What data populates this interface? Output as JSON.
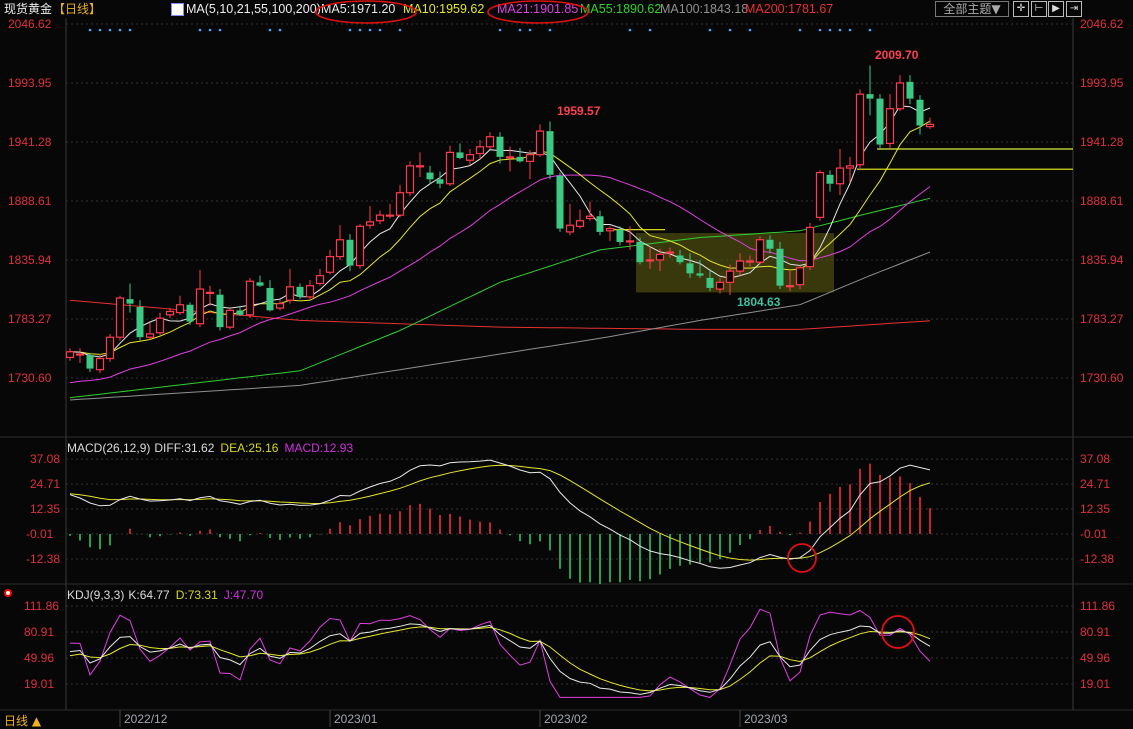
{
  "header": {
    "symbol": "现货黄金",
    "period_tag": "【日线】",
    "ma_params": "MA(5,10,21,55,100,200)",
    "ma5": "MA5:1971.20",
    "ma10": "MA10:1959.62",
    "ma21": "MA21:1901.85",
    "ma55": "MA55:1890.62",
    "ma100": "MA100:1843.18",
    "ma200": "MA200:1781.67",
    "theme_button": "全部主题▼",
    "tools": [
      "crosshair-icon",
      "zoom-range-icon",
      "play-icon",
      "step-forward-icon"
    ]
  },
  "colors": {
    "up": "#ff3b4e",
    "down": "#3cc984",
    "ma5": "#e8e8e8",
    "ma10": "#e6e62c",
    "ma21": "#e040e0",
    "ma55": "#30d030",
    "ma100": "#909090",
    "ma200": "#e83030",
    "axis": "#e0303c",
    "annotation": "#e01010",
    "highlight": "#5a5a10"
  },
  "price_axis": [
    "2046.62",
    "1993.95",
    "1941.28",
    "1888.61",
    "1835.94",
    "1783.27",
    "1730.60"
  ],
  "macd_axis": [
    "37.08",
    "24.71",
    "12.35",
    "-0.01",
    "-12.38"
  ],
  "kdj_axis": [
    "111.86",
    "80.91",
    "49.96",
    "19.01"
  ],
  "macd_title": {
    "name": "MACD(26,12,9)",
    "diff": "DIFF:31.62",
    "dea": "DEA:25.16",
    "macd": "MACD:12.93"
  },
  "kdj_title": {
    "name": "KDJ(9,3,3)",
    "k": "K:64.77",
    "d": "D:73.31",
    "j": "J:47.70"
  },
  "time_axis": [
    {
      "label": "2022/12",
      "index": 5
    },
    {
      "label": "2023/01",
      "index": 26
    },
    {
      "label": "2023/02",
      "index": 47
    },
    {
      "label": "2023/03",
      "index": 67
    }
  ],
  "footer": {
    "period": "日线 ▲"
  },
  "annotations": {
    "high1": "1959.57",
    "low1": "1804.63",
    "high2": "2009.70"
  },
  "chart_data": {
    "type": "candlestick",
    "title": "现货黄金 日线",
    "ylim": [
      1730.6,
      2046.62
    ],
    "candles": [
      [
        1749,
        1757,
        1746,
        1754
      ],
      [
        1752,
        1757,
        1744,
        1752
      ],
      [
        1751,
        1753,
        1736,
        1739
      ],
      [
        1738,
        1752,
        1735,
        1748
      ],
      [
        1748,
        1770,
        1745,
        1767
      ],
      [
        1767,
        1804,
        1764,
        1802
      ],
      [
        1801,
        1815,
        1789,
        1797
      ],
      [
        1794,
        1800,
        1764,
        1767
      ],
      [
        1767,
        1780,
        1765,
        1770
      ],
      [
        1771,
        1789,
        1769,
        1784
      ],
      [
        1787,
        1793,
        1784,
        1790
      ],
      [
        1789,
        1804,
        1787,
        1796
      ],
      [
        1796,
        1798,
        1778,
        1781
      ],
      [
        1779,
        1827,
        1776,
        1810
      ],
      [
        1807,
        1813,
        1795,
        1807
      ],
      [
        1805,
        1810,
        1773,
        1776
      ],
      [
        1776,
        1793,
        1774,
        1791
      ],
      [
        1791,
        1795,
        1786,
        1787
      ],
      [
        1787,
        1820,
        1784,
        1817
      ],
      [
        1816,
        1822,
        1812,
        1813
      ],
      [
        1811,
        1818,
        1790,
        1791
      ],
      [
        1793,
        1800,
        1791,
        1797
      ],
      [
        1800,
        1828,
        1797,
        1812
      ],
      [
        1812,
        1815,
        1801,
        1803
      ],
      [
        1803,
        1818,
        1800,
        1813
      ],
      [
        1815,
        1828,
        1813,
        1822
      ],
      [
        1825,
        1845,
        1823,
        1839
      ],
      [
        1839,
        1867,
        1836,
        1854
      ],
      [
        1854,
        1859,
        1826,
        1831
      ],
      [
        1831,
        1868,
        1828,
        1866
      ],
      [
        1867,
        1884,
        1864,
        1870
      ],
      [
        1871,
        1880,
        1868,
        1876
      ],
      [
        1876,
        1886,
        1873,
        1876
      ],
      [
        1876,
        1903,
        1874,
        1896
      ],
      [
        1896,
        1924,
        1893,
        1920
      ],
      [
        1920,
        1932,
        1910,
        1920
      ],
      [
        1914,
        1920,
        1904,
        1908
      ],
      [
        1908,
        1915,
        1900,
        1904
      ],
      [
        1904,
        1938,
        1902,
        1932
      ],
      [
        1932,
        1940,
        1926,
        1927
      ],
      [
        1925,
        1935,
        1921,
        1930
      ],
      [
        1931,
        1943,
        1926,
        1937
      ],
      [
        1937,
        1950,
        1935,
        1946
      ],
      [
        1946,
        1950,
        1922,
        1928
      ],
      [
        1928,
        1937,
        1915,
        1928
      ],
      [
        1928,
        1936,
        1923,
        1924
      ],
      [
        1924,
        1934,
        1908,
        1930
      ],
      [
        1930,
        1957,
        1928,
        1951
      ],
      [
        1951,
        1959.57,
        1908,
        1912
      ],
      [
        1911,
        1914,
        1861,
        1864
      ],
      [
        1861,
        1886,
        1858,
        1867
      ],
      [
        1866,
        1881,
        1864,
        1871
      ],
      [
        1873,
        1888,
        1871,
        1875
      ],
      [
        1875,
        1880,
        1858,
        1861
      ],
      [
        1862,
        1866,
        1853,
        1864
      ],
      [
        1863,
        1866,
        1849,
        1852
      ],
      [
        1853,
        1866,
        1845,
        1853
      ],
      [
        1852,
        1856,
        1832,
        1834
      ],
      [
        1836,
        1848,
        1828,
        1836
      ],
      [
        1836,
        1846,
        1826,
        1841
      ],
      [
        1843,
        1847,
        1838,
        1843
      ],
      [
        1840,
        1845,
        1832,
        1834
      ],
      [
        1833,
        1842,
        1820,
        1824
      ],
      [
        1824,
        1836,
        1820,
        1822
      ],
      [
        1820,
        1828,
        1808,
        1811
      ],
      [
        1810,
        1820,
        1806,
        1816
      ],
      [
        1816,
        1832,
        1804.63,
        1826
      ],
      [
        1826,
        1842,
        1822,
        1835
      ],
      [
        1835,
        1840,
        1830,
        1835
      ],
      [
        1834,
        1857,
        1832,
        1854
      ],
      [
        1854,
        1858,
        1842,
        1846
      ],
      [
        1846,
        1852,
        1810,
        1813
      ],
      [
        1813,
        1826,
        1808,
        1813
      ],
      [
        1814,
        1831,
        1810,
        1829
      ],
      [
        1830,
        1869,
        1827,
        1865
      ],
      [
        1874,
        1916,
        1871,
        1914
      ],
      [
        1912,
        1916,
        1897,
        1904
      ],
      [
        1904,
        1935,
        1894,
        1918
      ],
      [
        1918,
        1928,
        1905,
        1920
      ],
      [
        1921,
        1988,
        1918,
        1984
      ],
      [
        1984,
        2009.7,
        1965,
        1980
      ],
      [
        1980,
        1984,
        1936,
        1939
      ],
      [
        1940,
        1984,
        1936,
        1971
      ],
      [
        1971,
        2001,
        1969,
        1994
      ],
      [
        1995,
        2001,
        1975,
        1980
      ],
      [
        1979,
        1983,
        1948,
        1956
      ],
      [
        1955,
        1963,
        1953,
        1957
      ]
    ],
    "ma_anchors": {
      "ma55": [
        [
          0,
          1713
        ],
        [
          23,
          1737
        ],
        [
          33,
          1773
        ],
        [
          43,
          1816
        ],
        [
          53,
          1845
        ],
        [
          63,
          1856
        ],
        [
          73,
          1862
        ],
        [
          80,
          1878
        ],
        [
          86,
          1891
        ]
      ],
      "ma100": [
        [
          0,
          1711
        ],
        [
          23,
          1724
        ],
        [
          43,
          1752
        ],
        [
          53,
          1766
        ],
        [
          63,
          1782
        ],
        [
          73,
          1796
        ],
        [
          80,
          1822
        ],
        [
          86,
          1843
        ]
      ],
      "ma200": [
        [
          0,
          1800
        ],
        [
          23,
          1782
        ],
        [
          43,
          1776
        ],
        [
          63,
          1774
        ],
        [
          73,
          1774
        ],
        [
          86,
          1781.67
        ]
      ]
    },
    "ma_pad": {
      "ma21": 1725
    },
    "macd_range": [
      -12.38,
      37.08
    ],
    "kdj_range": [
      19.01,
      111.86
    ],
    "event_marker_indices": [
      2,
      3,
      4,
      5,
      6,
      13,
      14,
      15,
      20,
      21,
      28,
      29,
      30,
      31,
      33,
      43,
      45,
      46,
      48,
      56,
      58,
      64,
      66,
      68,
      73,
      75,
      76,
      77,
      78,
      80
    ],
    "support_lines": [
      {
        "price": 1935,
        "from_index": 81
      },
      {
        "price": 1917,
        "from_index": 79
      },
      {
        "price": 1863,
        "from_index": 54,
        "to_index": 59
      }
    ],
    "consolidation_box": {
      "from_index": 57,
      "to_index": 76,
      "low": 1807,
      "high": 1860
    }
  }
}
